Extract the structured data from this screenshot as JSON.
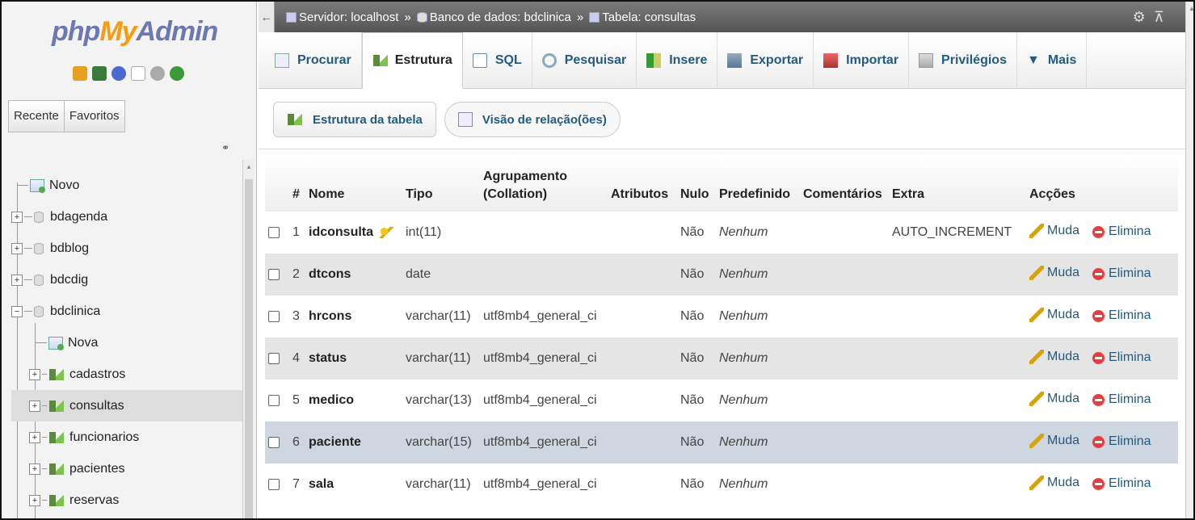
{
  "nav": {
    "logo_php": "php",
    "logo_my": "My",
    "logo_admin": "Admin",
    "icons": [
      "home-icon",
      "database-icon",
      "help-icon",
      "docs-icon",
      "settings-icon",
      "reload-icon"
    ],
    "tabs": [
      "Recente",
      "Favoritos"
    ],
    "tree": [
      {
        "label": "Novo",
        "type": "new",
        "level": 0
      },
      {
        "label": "bdagenda",
        "type": "db",
        "level": 0
      },
      {
        "label": "bdblog",
        "type": "db",
        "level": 0
      },
      {
        "label": "bdcdig",
        "type": "db",
        "level": 0
      },
      {
        "label": "bdclinica",
        "type": "db",
        "level": 0,
        "expanded": true
      },
      {
        "label": "Nova",
        "type": "new",
        "level": 1
      },
      {
        "label": "cadastros",
        "type": "table",
        "level": 1
      },
      {
        "label": "consultas",
        "type": "table",
        "level": 1,
        "selected": true
      },
      {
        "label": "funcionarios",
        "type": "table",
        "level": 1
      },
      {
        "label": "pacientes",
        "type": "table",
        "level": 1
      },
      {
        "label": "reservas",
        "type": "table",
        "level": 1
      }
    ]
  },
  "breadcrumb": {
    "server": "Servidor: localhost",
    "database": "Banco de dados: bdclinica",
    "table": "Tabela: consultas",
    "sep": "»"
  },
  "tabs": [
    "Procurar",
    "Estrutura",
    "SQL",
    "Pesquisar",
    "Insere",
    "Exportar",
    "Importar",
    "Privilégios",
    "Mais"
  ],
  "active_tab": "Estrutura",
  "subtabs": [
    "Estrutura da tabela",
    "Visão de relação(ões)"
  ],
  "table": {
    "headers": {
      "num": "#",
      "name": "Nome",
      "type": "Tipo",
      "collation": "Agrupamento (Collation)",
      "attributes": "Atributos",
      "null": "Nulo",
      "default": "Predefinido",
      "comments": "Comentários",
      "extra": "Extra",
      "actions": "Acções"
    },
    "rows": [
      {
        "num": "1",
        "name": "idconsulta",
        "type": "int(11)",
        "collation": "",
        "null": "Não",
        "default": "Nenhum",
        "extra": "AUTO_INCREMENT",
        "key": true
      },
      {
        "num": "2",
        "name": "dtcons",
        "type": "date",
        "collation": "",
        "null": "Não",
        "default": "Nenhum",
        "extra": ""
      },
      {
        "num": "3",
        "name": "hrcons",
        "type": "varchar(11)",
        "collation": "utf8mb4_general_ci",
        "null": "Não",
        "default": "Nenhum",
        "extra": ""
      },
      {
        "num": "4",
        "name": "status",
        "type": "varchar(11)",
        "collation": "utf8mb4_general_ci",
        "null": "Não",
        "default": "Nenhum",
        "extra": ""
      },
      {
        "num": "5",
        "name": "medico",
        "type": "varchar(13)",
        "collation": "utf8mb4_general_ci",
        "null": "Não",
        "default": "Nenhum",
        "extra": ""
      },
      {
        "num": "6",
        "name": "paciente",
        "type": "varchar(15)",
        "collation": "utf8mb4_general_ci",
        "null": "Não",
        "default": "Nenhum",
        "extra": "",
        "highlight": true
      },
      {
        "num": "7",
        "name": "sala",
        "type": "varchar(11)",
        "collation": "utf8mb4_general_ci",
        "null": "Não",
        "default": "Nenhum",
        "extra": ""
      }
    ],
    "action_edit": "Muda",
    "action_delete": "Elimina"
  },
  "colors": {
    "link": "#235a81",
    "logo_blue": "#6c78af",
    "logo_orange": "#f89c0e",
    "highlight_row": "#ced6e0"
  }
}
